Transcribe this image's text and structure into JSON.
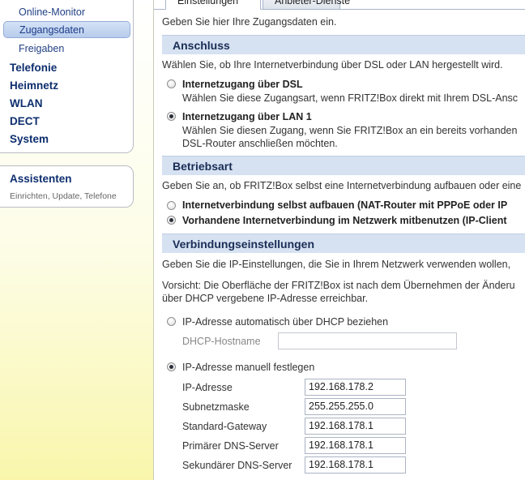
{
  "sidebar": {
    "sub_items": [
      "Online-Monitor",
      "Zugangsdaten",
      "Freigaben"
    ],
    "selected": "Zugangsdaten",
    "main_items": [
      "Telefonie",
      "Heimnetz",
      "WLAN",
      "DECT",
      "System"
    ],
    "assistant": {
      "title": "Assistenten",
      "subtitle": "Einrichten, Update, Telefone"
    }
  },
  "tabs": [
    "Einstellungen",
    "Anbieter-Dienste"
  ],
  "intro": "Geben Sie hier Ihre Zugangsdaten ein.",
  "anschluss": {
    "title": "Anschluss",
    "description": "Wählen Sie, ob Ihre Internetverbindung über DSL oder LAN hergestellt wird.",
    "options": [
      {
        "title": "Internetzugang über DSL",
        "desc": [
          "Wählen Sie diese Zugangsart, wenn FRITZ!Box direkt mit Ihrem DSL-Ansc"
        ],
        "checked": false
      },
      {
        "title": "Internetzugang über LAN 1",
        "desc": [
          "Wählen Sie diesen Zugang, wenn Sie FRITZ!Box an ein bereits vorhanden",
          "DSL-Router anschließen möchten."
        ],
        "checked": true
      }
    ]
  },
  "betriebsart": {
    "title": "Betriebsart",
    "description": "Geben Sie an, ob FRITZ!Box selbst eine Internetverbindung aufbauen oder eine",
    "options": [
      {
        "title": "Internetverbindung selbst aufbauen (NAT-Router mit PPPoE oder IP",
        "checked": false
      },
      {
        "title": "Vorhandene Internetverbindung im Netzwerk mitbenutzen (IP-Client",
        "checked": true
      }
    ]
  },
  "verbindung": {
    "title": "Verbindungseinstellungen",
    "description": "Geben Sie die IP-Einstellungen, die Sie in Ihrem Netzwerk verwenden wollen,",
    "warning": [
      "Vorsicht: Die Oberfläche der FRITZ!Box ist nach dem Übernehmen der Änderu",
      "über DHCP vergebene IP-Adresse erreichbar."
    ],
    "dhcp_option": {
      "label": "IP-Adresse automatisch über DHCP beziehen",
      "checked": false
    },
    "hostname_label": "DHCP-Hostname",
    "hostname_value": "",
    "manual_option": {
      "label": "IP-Adresse manuell festlegen",
      "checked": true
    },
    "fields": [
      {
        "label": "IP-Adresse",
        "value": "192.168.178.2"
      },
      {
        "label": "Subnetzmaske",
        "value": "255.255.255.0"
      },
      {
        "label": "Standard-Gateway",
        "value": "192.168.178.1"
      },
      {
        "label": "Primärer DNS-Server",
        "value": "192.168.178.1"
      },
      {
        "label": "Sekundärer DNS-Server",
        "value": "192.168.178.1"
      }
    ]
  }
}
